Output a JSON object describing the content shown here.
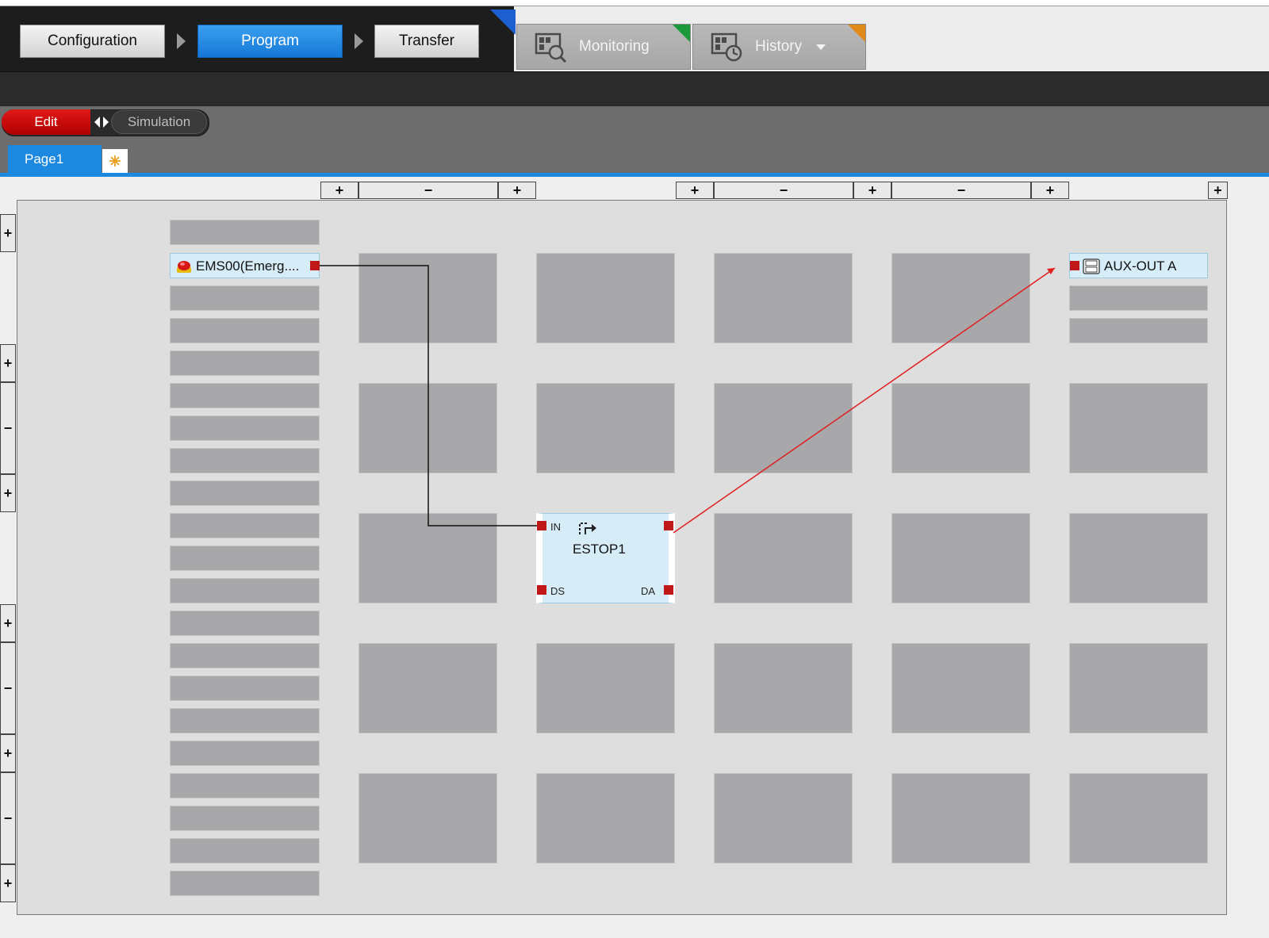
{
  "nav": {
    "steps": [
      "Configuration",
      "Program",
      "Transfer"
    ],
    "active_step": "Program",
    "monitor_tabs": [
      {
        "label": "Monitoring",
        "icon": "monitoring-icon",
        "flag_color": "#1a9a3a"
      },
      {
        "label": "History",
        "icon": "history-icon",
        "flag_color": "#e08a1a"
      }
    ]
  },
  "mode": {
    "edit": "Edit",
    "simulation": "Simulation",
    "active": "Edit"
  },
  "pages": {
    "tabs": [
      "Page1"
    ],
    "add_icon": "add-page-icon"
  },
  "canvas": {
    "column_controls": [
      "+",
      "−",
      "+",
      "+",
      "−",
      "+",
      "−",
      "+",
      "+"
    ],
    "row_controls": [
      "+",
      "+",
      "−",
      "+",
      "+",
      "−",
      "+",
      "−",
      "+"
    ]
  },
  "blocks": {
    "input": {
      "label": "EMS00(Emerg....",
      "icon": "emergency-stop-icon"
    },
    "function": {
      "label": "ESTOP1",
      "icon": "function-block-icon",
      "ports": {
        "in": "IN",
        "ds": "DS",
        "da": "DA"
      }
    },
    "output": {
      "label": "AUX-OUT A",
      "icon": "aux-out-icon"
    }
  },
  "colors": {
    "accent_blue": "#1c88e0",
    "edit_red": "#d10f0f",
    "port_red": "#c01818",
    "link_red": "#e02020",
    "link_black": "#111111"
  }
}
